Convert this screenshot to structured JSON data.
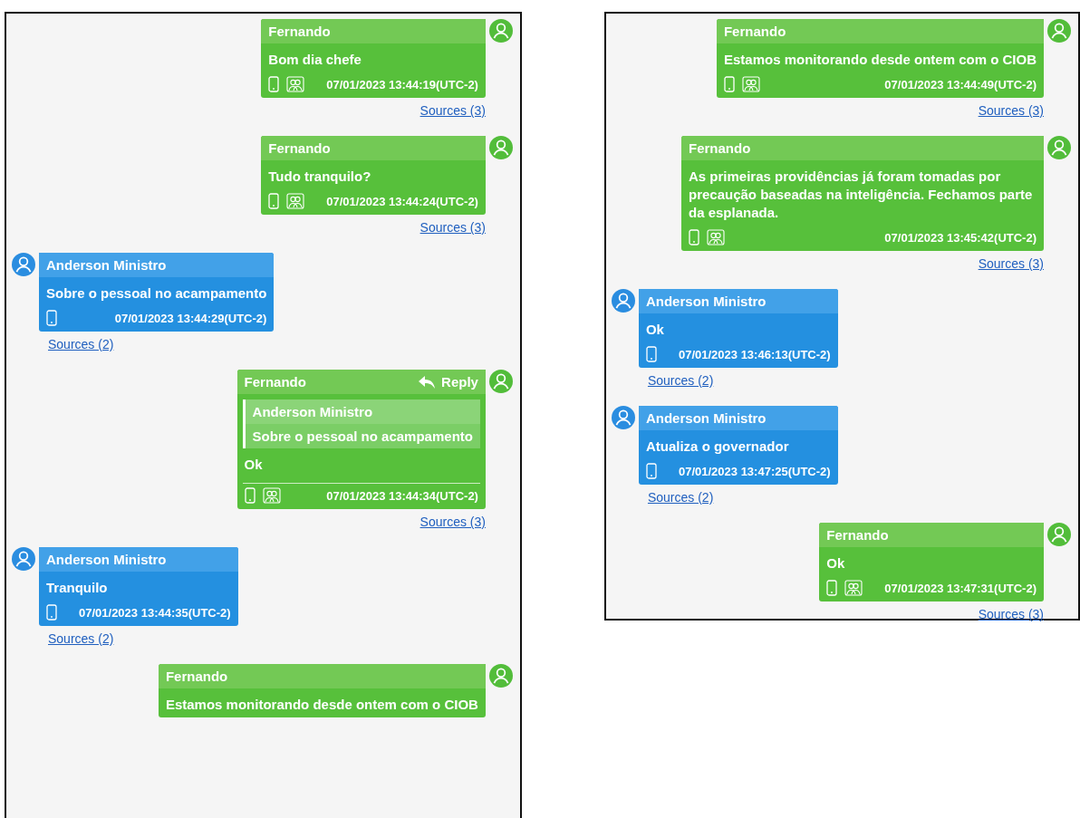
{
  "panels": [
    {
      "messages": [
        {
          "kind": "outgoing",
          "sender": "Fernando",
          "text": "Bom dia chefe",
          "timestamp": "07/01/2023 13:44:19(UTC-2)",
          "sources": "Sources (3)"
        },
        {
          "kind": "outgoing",
          "sender": "Fernando",
          "text": "Tudo tranquilo?",
          "timestamp": "07/01/2023 13:44:24(UTC-2)",
          "sources": "Sources (3)"
        },
        {
          "kind": "incoming",
          "sender": "Anderson Ministro",
          "text": "Sobre o pessoal no acampamento",
          "timestamp": "07/01/2023 13:44:29(UTC-2)",
          "sources": "Sources (2)"
        },
        {
          "kind": "outgoing",
          "sender": "Fernando",
          "reply_label": "Reply",
          "quote": {
            "sender": "Anderson Ministro",
            "text": "Sobre o pessoal no acampamento"
          },
          "text": "Ok",
          "timestamp": "07/01/2023 13:44:34(UTC-2)",
          "sources": "Sources (3)"
        },
        {
          "kind": "incoming",
          "sender": "Anderson Ministro",
          "text": "Tranquilo",
          "timestamp": "07/01/2023 13:44:35(UTC-2)",
          "sources": "Sources (2)"
        },
        {
          "kind": "outgoing",
          "sender": "Fernando",
          "text": "Estamos monitorando desde ontem com o CIOB"
        }
      ]
    },
    {
      "messages": [
        {
          "kind": "outgoing",
          "sender": "Fernando",
          "text": "Estamos monitorando desde ontem com o CIOB",
          "timestamp": "07/01/2023 13:44:49(UTC-2)",
          "sources": "Sources (3)"
        },
        {
          "kind": "outgoing",
          "sender": "Fernando",
          "text": "As primeiras providências já foram tomadas por precaução baseadas na inteligência. Fechamos parte da esplanada.",
          "timestamp": "07/01/2023 13:45:42(UTC-2)",
          "sources": "Sources (3)"
        },
        {
          "kind": "incoming",
          "sender": "Anderson Ministro",
          "text": "Ok",
          "timestamp": "07/01/2023 13:46:13(UTC-2)",
          "sources": "Sources (2)"
        },
        {
          "kind": "incoming",
          "sender": "Anderson Ministro",
          "text": "Atualiza o governador",
          "timestamp": "07/01/2023 13:47:25(UTC-2)",
          "sources": "Sources (2)"
        },
        {
          "kind": "outgoing",
          "sender": "Fernando",
          "text": "Ok",
          "timestamp": "07/01/2023 13:47:31(UTC-2)",
          "sources": "Sources (3)"
        }
      ]
    }
  ]
}
